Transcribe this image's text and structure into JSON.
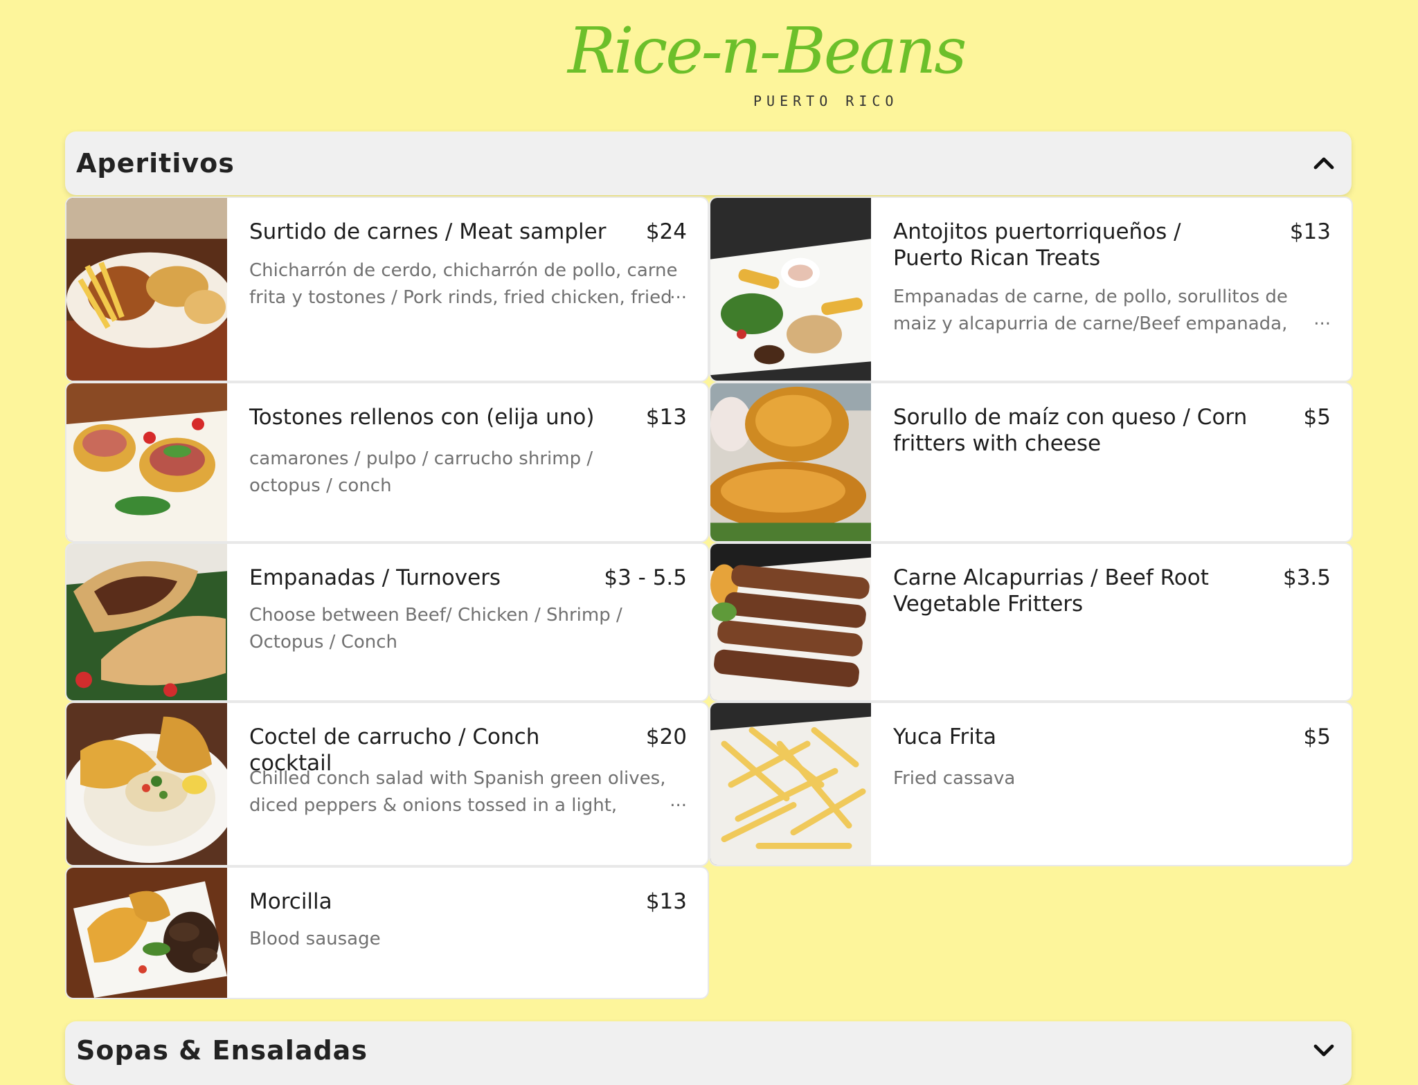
{
  "logo": {
    "main": "Rice-n-Beans",
    "sub": "PUERTO RICO"
  },
  "sections": [
    {
      "title": "Aperitivos",
      "expanded": true,
      "chevron": "chevron-up-icon"
    },
    {
      "title": "Sopas & Ensaladas",
      "expanded": false,
      "chevron": "chevron-down-icon"
    }
  ],
  "items": [
    {
      "name": "Surtido de carnes / Meat sampler",
      "price": "$24",
      "desc": "Chicharrón de cerdo, chicharrón de pollo, carne frita y tostones / Pork rinds, fried chicken, fried pork",
      "truncated": true
    },
    {
      "name": "Antojitos puertorriqueños / Puerto Rican Treats",
      "price": "$13",
      "desc": "Empanadas de carne, de pollo, sorullitos de maiz y alcapurria de carne/Beef empanada, chicken",
      "truncated": true
    },
    {
      "name": "Tostones rellenos con (elija uno)",
      "price": "$13",
      "desc": "camarones / pulpo / carrucho shrimp / octopus / conch",
      "truncated": false
    },
    {
      "name": "Sorullo de maíz con queso / Corn fritters with cheese",
      "price": "$5",
      "desc": "",
      "truncated": false
    },
    {
      "name": "Empanadas / Turnovers",
      "price": "$3 - 5.5",
      "desc": "Choose between Beef/ Chicken / Shrimp / Octopus / Conch",
      "truncated": false
    },
    {
      "name": "Carne Alcapurrias / Beef Root Vegetable Fritters",
      "price": "$3.5",
      "desc": "",
      "truncated": false
    },
    {
      "name": "Coctel de carrucho / Conch cocktail",
      "price": "$20",
      "desc": "Chilled conch salad with Spanish green olives, diced peppers & onions tossed in a light, house-made",
      "truncated": true
    },
    {
      "name": "Yuca Frita",
      "price": "$5",
      "desc": "Fried cassava",
      "truncated": false
    },
    {
      "name": "Morcilla",
      "price": "$13",
      "desc": "Blood sausage",
      "truncated": false
    }
  ],
  "ellipsis": "...",
  "colors": {
    "background": "#fdf59b",
    "logo_green": "#6cbf2a",
    "header_bg": "#f0f0f0"
  }
}
